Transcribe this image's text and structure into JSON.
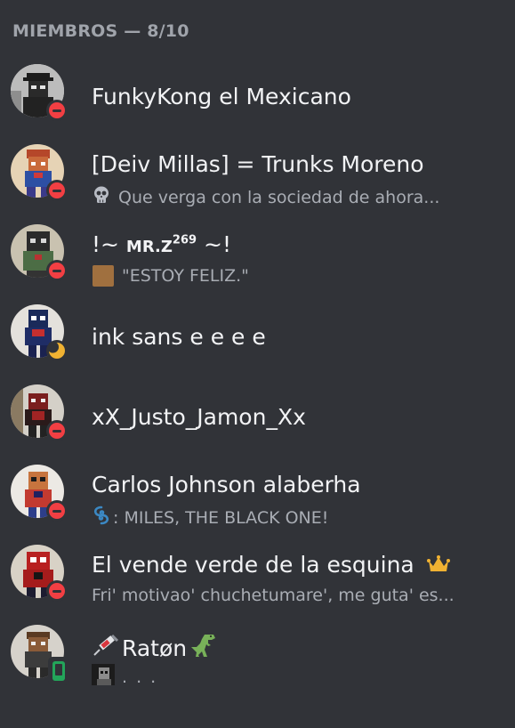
{
  "header": {
    "title": "MIEMBROS — 8/10"
  },
  "members": [
    {
      "name": "FunkyKong el Mexicano",
      "status": "dnd",
      "activity": ""
    },
    {
      "name": "[Deiv Millas] = Trunks Moreno",
      "status": "dnd",
      "activity_icon": "skull-icon",
      "activity": "Que verga con la sociedad de ahora..."
    },
    {
      "name_prefix": "!~ ",
      "name_small": "MR.Z",
      "name_sup": "269",
      "name_suffix": " ~!",
      "status": "dnd",
      "activity_icon": "brown-square-icon",
      "activity": "\"ESTOY FELIZ.\""
    },
    {
      "name": "ink sans e e e e",
      "status": "idle",
      "activity": ""
    },
    {
      "name": "xX_Justo_Jamon_Xx",
      "status": "dnd",
      "activity": ""
    },
    {
      "name": "Carlos Johnson alaberha",
      "status": "dnd",
      "activity_icon": "cyclone-icon",
      "activity": ": MILES, THE BLACK ONE!"
    },
    {
      "name": "El vende verde de la esquina",
      "name_icon": "crown-icon",
      "status": "dnd",
      "activity": "Fri' motivao' chuchetumare', me guta' es..."
    },
    {
      "name_icon_before": "syringe-icon",
      "name": "Ratøn",
      "name_icon_after": "t-rex-icon",
      "status": "mobile-online",
      "activity_icon": "custom-emoji-icon",
      "activity": ". . ."
    }
  ],
  "colors": {
    "background": "#313338",
    "header": "#a0a4ab",
    "name": "#f2f3f5",
    "activity": "#a9adb4",
    "dnd": "#f23f43",
    "idle": "#f0b232",
    "online": "#23a55a",
    "crown": "#f0b232"
  }
}
